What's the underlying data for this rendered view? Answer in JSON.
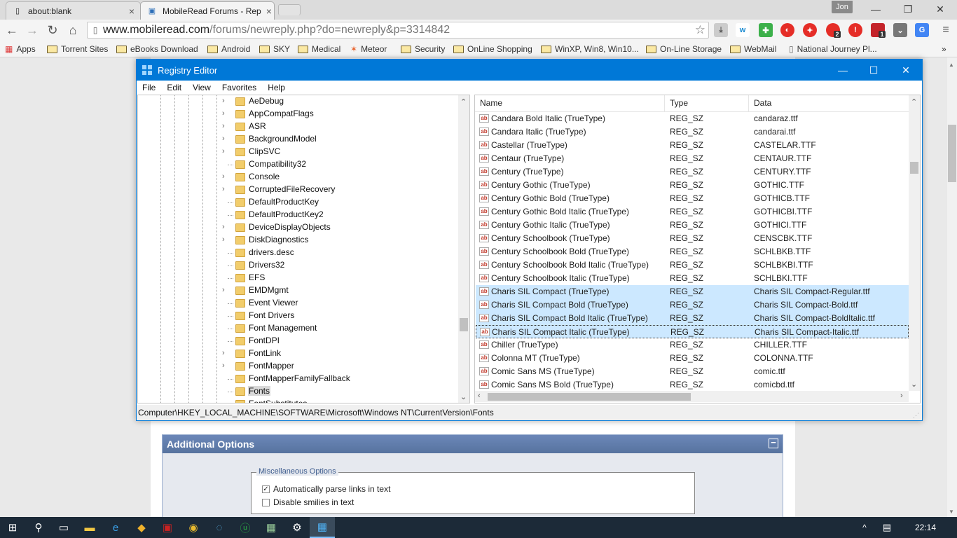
{
  "browser": {
    "tabs": [
      {
        "label": "about:blank"
      },
      {
        "label": "MobileRead Forums - Rep"
      }
    ],
    "user": "Jon",
    "url_host": "www.mobileread.com",
    "url_path": "/forums/newreply.php?do=newreply&p=3314842",
    "bookmarks": [
      "Apps",
      "Torrent Sites",
      "eBooks Download",
      "Android",
      "SKY",
      "Medical",
      "Meteor",
      "Security",
      "OnLine Shopping",
      "WinXP, Win8, Win10...",
      "On-Line Storage",
      "WebMail",
      "National Journey Pl..."
    ],
    "ext_badges": {
      "a": "2",
      "b": "1"
    }
  },
  "page": {
    "additional_options": "Additional Options",
    "collapse": "−",
    "misc_legend": "Miscellaneous Options",
    "opt_parse_links": "Automatically parse links in text",
    "opt_disable_smilies": "Disable smilies in text",
    "opt_parse_links_checked": true,
    "opt_disable_smilies_checked": false
  },
  "regedit": {
    "title": "Registry Editor",
    "menu": [
      "File",
      "Edit",
      "View",
      "Favorites",
      "Help"
    ],
    "tree": [
      {
        "label": "AeDebug",
        "expand": true
      },
      {
        "label": "AppCompatFlags",
        "expand": true
      },
      {
        "label": "ASR",
        "expand": true
      },
      {
        "label": "BackgroundModel",
        "expand": true
      },
      {
        "label": "ClipSVC",
        "expand": true
      },
      {
        "label": "Compatibility32",
        "expand": false
      },
      {
        "label": "Console",
        "expand": true
      },
      {
        "label": "CorruptedFileRecovery",
        "expand": true
      },
      {
        "label": "DefaultProductKey",
        "expand": false
      },
      {
        "label": "DefaultProductKey2",
        "expand": false
      },
      {
        "label": "DeviceDisplayObjects",
        "expand": true
      },
      {
        "label": "DiskDiagnostics",
        "expand": true
      },
      {
        "label": "drivers.desc",
        "expand": false
      },
      {
        "label": "Drivers32",
        "expand": false
      },
      {
        "label": "EFS",
        "expand": false
      },
      {
        "label": "EMDMgmt",
        "expand": true
      },
      {
        "label": "Event Viewer",
        "expand": false
      },
      {
        "label": "Font Drivers",
        "expand": false
      },
      {
        "label": "Font Management",
        "expand": false
      },
      {
        "label": "FontDPI",
        "expand": false
      },
      {
        "label": "FontLink",
        "expand": true
      },
      {
        "label": "FontMapper",
        "expand": true
      },
      {
        "label": "FontMapperFamilyFallback",
        "expand": false
      },
      {
        "label": "Fonts",
        "expand": false,
        "selected": true
      },
      {
        "label": "FontSubstitutes",
        "expand": false
      }
    ],
    "columns": [
      "Name",
      "Type",
      "Data"
    ],
    "rows": [
      {
        "name": "Candara Bold Italic (TrueType)",
        "type": "REG_SZ",
        "data": "candaraz.ttf"
      },
      {
        "name": "Candara Italic (TrueType)",
        "type": "REG_SZ",
        "data": "candarai.ttf"
      },
      {
        "name": "Castellar (TrueType)",
        "type": "REG_SZ",
        "data": "CASTELAR.TTF"
      },
      {
        "name": "Centaur (TrueType)",
        "type": "REG_SZ",
        "data": "CENTAUR.TTF"
      },
      {
        "name": "Century (TrueType)",
        "type": "REG_SZ",
        "data": "CENTURY.TTF"
      },
      {
        "name": "Century Gothic (TrueType)",
        "type": "REG_SZ",
        "data": "GOTHIC.TTF"
      },
      {
        "name": "Century Gothic Bold (TrueType)",
        "type": "REG_SZ",
        "data": "GOTHICB.TTF"
      },
      {
        "name": "Century Gothic Bold Italic (TrueType)",
        "type": "REG_SZ",
        "data": "GOTHICBI.TTF"
      },
      {
        "name": "Century Gothic Italic (TrueType)",
        "type": "REG_SZ",
        "data": "GOTHICI.TTF"
      },
      {
        "name": "Century Schoolbook (TrueType)",
        "type": "REG_SZ",
        "data": "CENSCBK.TTF"
      },
      {
        "name": "Century Schoolbook Bold (TrueType)",
        "type": "REG_SZ",
        "data": "SCHLBKB.TTF"
      },
      {
        "name": "Century Schoolbook Bold Italic (TrueType)",
        "type": "REG_SZ",
        "data": "SCHLBKBI.TTF"
      },
      {
        "name": "Century Schoolbook Italic (TrueType)",
        "type": "REG_SZ",
        "data": "SCHLBKI.TTF"
      },
      {
        "name": "Charis SIL Compact (TrueType)",
        "type": "REG_SZ",
        "data": "Charis SIL Compact-Regular.ttf",
        "selected": true
      },
      {
        "name": "Charis SIL Compact Bold (TrueType)",
        "type": "REG_SZ",
        "data": "Charis SIL Compact-Bold.ttf",
        "selected": true
      },
      {
        "name": "Charis SIL Compact Bold Italic (TrueType)",
        "type": "REG_SZ",
        "data": "Charis SIL Compact-BoldItalic.ttf",
        "selected": true
      },
      {
        "name": "Charis SIL Compact Italic (TrueType)",
        "type": "REG_SZ",
        "data": "Charis SIL Compact-Italic.ttf",
        "selected": true,
        "focus": true
      },
      {
        "name": "Chiller (TrueType)",
        "type": "REG_SZ",
        "data": "CHILLER.TTF"
      },
      {
        "name": "Colonna MT (TrueType)",
        "type": "REG_SZ",
        "data": "COLONNA.TTF"
      },
      {
        "name": "Comic Sans MS (TrueType)",
        "type": "REG_SZ",
        "data": "comic.ttf"
      },
      {
        "name": "Comic Sans MS Bold (TrueType)",
        "type": "REG_SZ",
        "data": "comicbd.ttf"
      }
    ],
    "status_path": "Computer\\HKEY_LOCAL_MACHINE\\SOFTWARE\\Microsoft\\Windows NT\\CurrentVersion\\Fonts"
  },
  "taskbar": {
    "clock": "22:14"
  },
  "colors": {
    "accent": "#0078d7",
    "selection": "#cce8ff",
    "taskbar": "#1c2a38"
  }
}
